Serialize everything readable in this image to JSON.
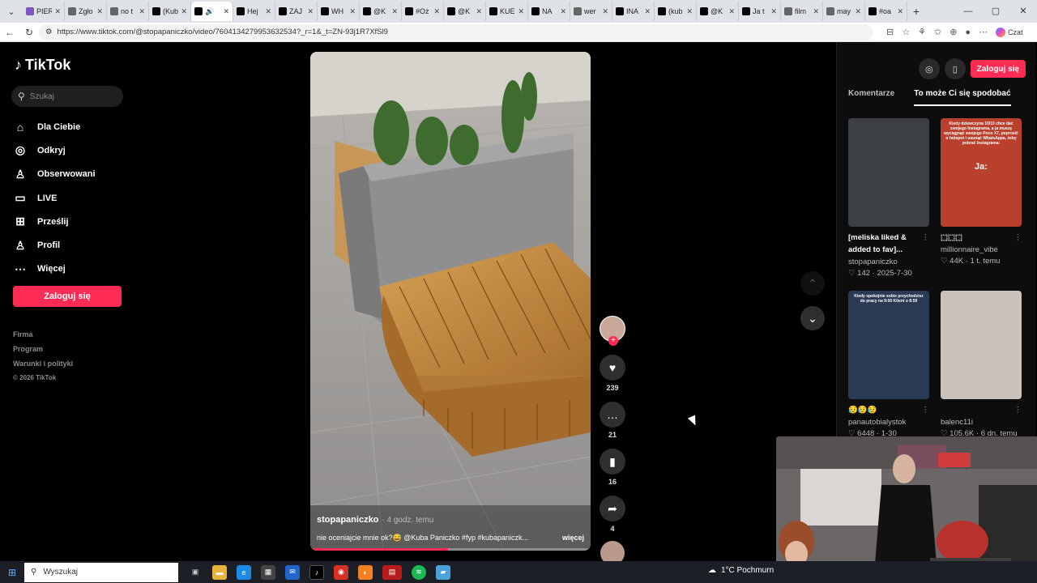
{
  "browser": {
    "tabs": [
      {
        "title": "PIER",
        "fav_color": "#7e57c2"
      },
      {
        "title": "Zgło",
        "fav_color": "#666666"
      },
      {
        "title": "no t",
        "fav_color": "#666666"
      },
      {
        "title": "(Kub",
        "fav_color": "#000000"
      },
      {
        "title": "",
        "fav_color": "#000000",
        "active": true
      },
      {
        "title": "Hej",
        "fav_color": "#000000"
      },
      {
        "title": "ZAJ",
        "fav_color": "#000000"
      },
      {
        "title": "WH",
        "fav_color": "#000000"
      },
      {
        "title": "@K",
        "fav_color": "#000000"
      },
      {
        "title": "#Oż",
        "fav_color": "#000000"
      },
      {
        "title": "@K",
        "fav_color": "#000000"
      },
      {
        "title": "KUE",
        "fav_color": "#000000"
      },
      {
        "title": "NA",
        "fav_color": "#000000"
      },
      {
        "title": "wer",
        "fav_color": "#666666"
      },
      {
        "title": "INA",
        "fav_color": "#000000"
      },
      {
        "title": "(kub",
        "fav_color": "#000000"
      },
      {
        "title": "@K",
        "fav_color": "#000000"
      },
      {
        "title": "Ja t",
        "fav_color": "#000000"
      },
      {
        "title": "film",
        "fav_color": "#666666"
      },
      {
        "title": "may",
        "fav_color": "#666666"
      },
      {
        "title": "#oa",
        "fav_color": "#000000"
      }
    ],
    "new_tab": "+",
    "url": "https://www.tiktok.com/@stopapaniczko/video/7604134279953632534?_r=1&_t=ZN-93j1R7XfSl9",
    "copilot_label": "Czat"
  },
  "sidebar": {
    "logo_text": "TikTok",
    "search_placeholder": "Szukaj",
    "nav": [
      {
        "label": "Dla Ciebie",
        "icon": "home-icon",
        "glyph": "⌂"
      },
      {
        "label": "Odkryj",
        "icon": "compass-icon",
        "glyph": "◎"
      },
      {
        "label": "Obserwowani",
        "icon": "user-follow-icon",
        "glyph": "♙"
      },
      {
        "label": "LIVE",
        "icon": "tv-icon",
        "glyph": "▭"
      },
      {
        "label": "Prześlij",
        "icon": "upload-plus-icon",
        "glyph": "⊞"
      },
      {
        "label": "Profil",
        "icon": "profile-icon",
        "glyph": "♙"
      },
      {
        "label": "Więcej",
        "icon": "more-dots-icon",
        "glyph": "⋯"
      }
    ],
    "login_label": "Zaloguj się",
    "footer": [
      "Firma",
      "Program",
      "Warunki i polityki"
    ],
    "copyright": "© 2026 TikTok"
  },
  "video": {
    "author": "stopapaniczko",
    "time_ago": "· 4 godz. temu",
    "description": "nie oceniajcie mnie ok?😅 @Kuba Paniczko #fyp #kubapaniczk...",
    "more_label": "więcej",
    "progress": 0.49,
    "likes": "239",
    "comments": "21",
    "saves": "16",
    "shares": "4"
  },
  "right_panel": {
    "login_label": "Zaloguj się",
    "tabs": [
      "Komentarze",
      "To może Ci się spodobać"
    ],
    "active_tab": 1,
    "cards": [
      {
        "title": "[meliska liked & added to fav]...",
        "author": "stopapaniczko",
        "meta": "♡ 142 · 2025-7-30",
        "thumb_text": "",
        "thumb_big": "",
        "color": "#3c3f44"
      },
      {
        "title": "⬚⬚⬚",
        "author": "millionnaire_vibe",
        "meta": "♡ 44K · 1 t. temu",
        "thumb_text": "Kiedy dziewczyna 10/10 chce dać swojego Instagrama, a ja muszę wyciągnąć swojego Poco X7, poprosić o hotspot i usunąć WhatsAppa, żeby pobrać Instagrama:",
        "thumb_big": "Ja:",
        "color": "#b8402c"
      },
      {
        "title": "😥😥😥",
        "author": "panautobialystok",
        "meta": "♡ 6448 · 1-30",
        "thumb_text": "Kiedy spokojnie sobie przychodzisz do pracy na 9:00 Klient o 8:59",
        "thumb_big": "",
        "color": "#2a3a55"
      },
      {
        "title": "",
        "author": "balenc11i",
        "meta": "♡ 105.6K · 6 dn. temu",
        "thumb_text": "",
        "thumb_big": "",
        "color": "#c9c2bc"
      }
    ]
  },
  "taskbar": {
    "search_placeholder": "Wyszukaj",
    "weather": "1°C Pochmurn"
  }
}
